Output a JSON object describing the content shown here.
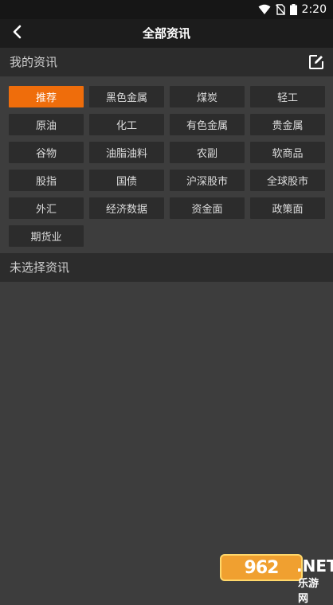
{
  "status_bar": {
    "time": "2:20"
  },
  "nav": {
    "title": "全部资讯",
    "back_icon": "chevron-left-icon"
  },
  "my_news": {
    "title": "我的资讯",
    "edit_icon": "edit-icon",
    "items": [
      {
        "label": "推荐",
        "selected": true
      },
      {
        "label": "黑色金属",
        "selected": false
      },
      {
        "label": "煤炭",
        "selected": false
      },
      {
        "label": "轻工",
        "selected": false
      },
      {
        "label": "原油",
        "selected": false
      },
      {
        "label": "化工",
        "selected": false
      },
      {
        "label": "有色金属",
        "selected": false
      },
      {
        "label": "贵金属",
        "selected": false
      },
      {
        "label": "谷物",
        "selected": false
      },
      {
        "label": "油脂油料",
        "selected": false
      },
      {
        "label": "农副",
        "selected": false
      },
      {
        "label": "软商品",
        "selected": false
      },
      {
        "label": "股指",
        "selected": false
      },
      {
        "label": "国债",
        "selected": false
      },
      {
        "label": "沪深股市",
        "selected": false
      },
      {
        "label": "全球股市",
        "selected": false
      },
      {
        "label": "外汇",
        "selected": false
      },
      {
        "label": "经济数据",
        "selected": false
      },
      {
        "label": "资金面",
        "selected": false
      },
      {
        "label": "政策面",
        "selected": false
      },
      {
        "label": "期货业",
        "selected": false
      }
    ]
  },
  "unselected_news": {
    "title": "未选择资讯"
  },
  "watermark": {
    "badge": "962",
    "suffix": ".NET",
    "subtitle": "乐游网"
  },
  "colors": {
    "accent": "#ef6d0b",
    "background": "#3d3d3d",
    "chip": "#2c2c2c",
    "navbar": "#1c1c1c"
  }
}
